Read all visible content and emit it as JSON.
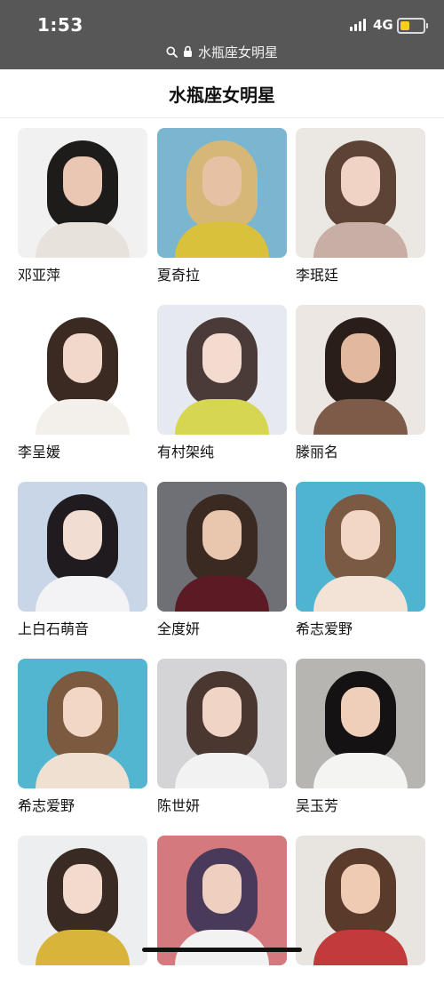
{
  "status_bar": {
    "time": "1:53",
    "network": "4G",
    "battery_level": 0.4,
    "battery_color": "#f5cf18"
  },
  "url_bar": {
    "search_icon": "search-icon",
    "lock_icon": "lock-icon",
    "text": "水瓶座女明星"
  },
  "header": {
    "title": "水瓶座女明星"
  },
  "items": [
    {
      "name": "邓亚萍",
      "bg": "#f1f1f1",
      "hair": "#1e1b1b",
      "face": "#e9c7b3",
      "body": "#e8e2dc"
    },
    {
      "name": "夏奇拉",
      "bg": "#7ab6cf",
      "hair": "#d7b777",
      "face": "#e7c1a4",
      "body": "#d9c13c"
    },
    {
      "name": "李珉廷",
      "bg": "#ebe7e3",
      "hair": "#5c4336",
      "face": "#f0d3c5",
      "body": "#c9aea5"
    },
    {
      "name": "李呈媛",
      "bg": "#ffffff",
      "hair": "#3a2a22",
      "face": "#f1d8cb",
      "body": "#f3efea"
    },
    {
      "name": "有村架纯",
      "bg": "#e6eaf0",
      "hair": "#4a3a38",
      "face": "#f3dccf",
      "body": "#d7d653"
    },
    {
      "name": "滕丽名",
      "bg": "#ece7e2",
      "hair": "#2a1e1a",
      "face": "#e2b99e",
      "body": "#7e5a48"
    },
    {
      "name": "上白石萌音",
      "bg": "#c9d6e8",
      "hair": "#1f1b1f",
      "face": "#f2ddd2",
      "body": "#f3f3f5"
    },
    {
      "name": "全度妍",
      "bg": "#6f7075",
      "hair": "#3b2a22",
      "face": "#e9c6ae",
      "body": "#5c1a24"
    },
    {
      "name": "希志爱野",
      "bg": "#4fb4cf",
      "hair": "#7a5a42",
      "face": "#f3d7c6",
      "body": "#f2e3d6"
    },
    {
      "name": "希志爱野",
      "bg": "#52b6d1",
      "hair": "#7b5a40",
      "face": "#f3d7c6",
      "body": "#efe0d2"
    },
    {
      "name": "陈世妍",
      "bg": "#d4d4d6",
      "hair": "#4a3830",
      "face": "#f0d5c6",
      "body": "#f2f2f2"
    },
    {
      "name": "吴玉芳",
      "bg": "#b7b5b1",
      "hair": "#141212",
      "face": "#efcfba",
      "body": "#f4f4f2"
    },
    {
      "name": "",
      "bg": "#eceeef",
      "hair": "#3a2a24",
      "face": "#f2dacd",
      "body": "#d9b43a"
    },
    {
      "name": "",
      "bg": "#d47a7e",
      "hair": "#4a3a5a",
      "face": "#efd0c0",
      "body": "#f2f2f2"
    },
    {
      "name": "",
      "bg": "#e8e4e0",
      "hair": "#5a3a2a",
      "face": "#efcbb4",
      "body": "#c23b3b"
    }
  ]
}
